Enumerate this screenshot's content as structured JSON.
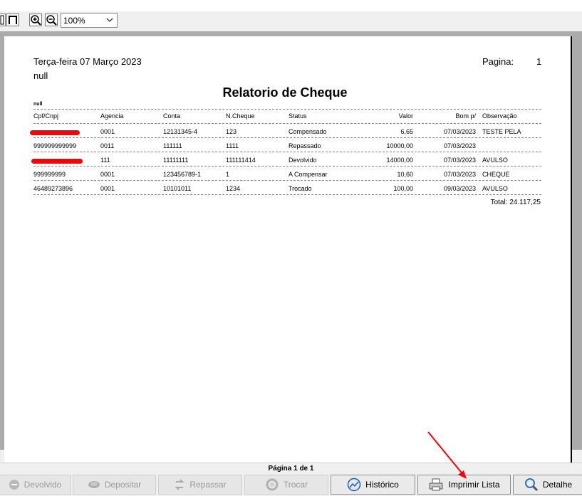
{
  "toolbar": {
    "zoom_value": "100%"
  },
  "report": {
    "date": "Terça-feira 07 Março 2023",
    "subtitle": "null",
    "page_label": "Pagina:",
    "page_number": "1",
    "title": "Relatorio de Cheque",
    "group_label": "null",
    "columns": [
      "Cpf/Cnpj",
      "Agencia",
      "Conta",
      "N.Cheque",
      "Status",
      "Valor",
      "Bom p/",
      "Observação"
    ],
    "rows": [
      [
        "",
        "0001",
        "12131345-4",
        "123",
        "Compensado",
        "6,65",
        "07/03/2023",
        "TESTE PELA"
      ],
      [
        "999999999999",
        "0011",
        "111111",
        "1111",
        "Repassado",
        "10000,00",
        "07/03/2023",
        ""
      ],
      [
        "",
        "111",
        "11111111",
        "111111414",
        "Devolvido",
        "14000,00",
        "07/03/2023",
        "AVULSO"
      ],
      [
        "999999999",
        "0001",
        "123456789-1",
        "1",
        "A Compensar",
        "10,60",
        "07/03/2023",
        "CHEQUE"
      ],
      [
        "46489273896",
        "0001",
        "10101011",
        "1234",
        "Trocado",
        "100,00",
        "09/03/2023",
        "AVULSO"
      ]
    ],
    "total": "Total: 24.117,25"
  },
  "footer": {
    "page_indicator": "Página 1 de 1",
    "buttons": {
      "devolvido": "Devolvido",
      "depositar": "Depositar",
      "repassar": "Repassar",
      "trocar": "Trocar",
      "historico": "Histórico",
      "imprimir": "Imprimir Lista",
      "detalhe": "Detalhe"
    }
  },
  "colors": {
    "redaction": "#ff0000",
    "annotation_arrow": "#ff0000"
  }
}
